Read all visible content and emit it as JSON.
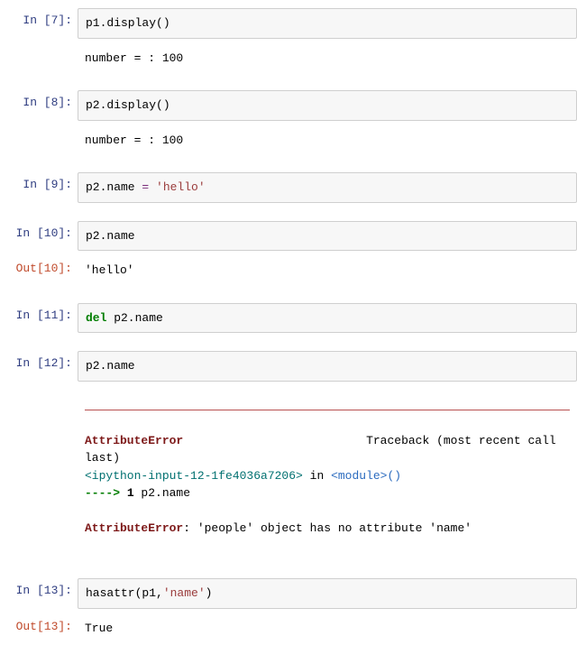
{
  "cells": {
    "c7": {
      "in_label": "In  [7]:",
      "code": "p1.display()",
      "out_label": "",
      "out": "number = : 100"
    },
    "c8": {
      "in_label": "In  [8]:",
      "code": "p2.display()",
      "out_label": "",
      "out": "number = : 100"
    },
    "c9": {
      "in_label": "In  [9]:",
      "code_plain_pre": "p2.name ",
      "op": "=",
      "str": " 'hello'"
    },
    "c10": {
      "in_label": "In [10]:",
      "code": "p2.name",
      "out_label": "Out[10]:",
      "out": "'hello'"
    },
    "c11": {
      "in_label": "In [11]:",
      "kw": "del",
      "rest": " p2.name"
    },
    "c12": {
      "in_label": "In [12]:",
      "code": "p2.name",
      "err_name": "AttributeError",
      "tb_label": "Traceback (most recent call last)",
      "ipy_input": "<ipython-input-12-1fe4036a7206>",
      "in_word": " in ",
      "module": "<module>",
      "parens": "()",
      "arrow": "----> ",
      "lineno": "1",
      "err_line_code": " p2.name",
      "err_msg_name": "AttributeError",
      "err_msg_rest": ": 'people' object has no attribute 'name'"
    },
    "c13": {
      "in_label": "In [13]:",
      "code_pre": "hasattr(p1,",
      "str": "'name'",
      "code_post": ")",
      "out_label": "Out[13]:",
      "out": "True"
    }
  }
}
